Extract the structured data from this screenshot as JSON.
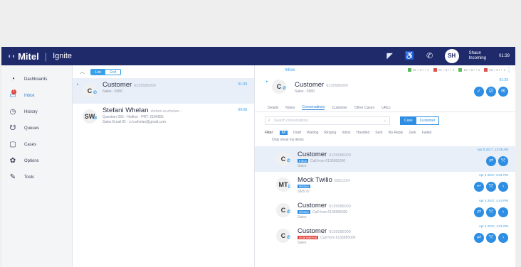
{
  "app": {
    "brand": "Mitel",
    "product": "Ignite"
  },
  "topbar": {
    "icons": [
      "megaphone-icon",
      "accessibility-icon",
      "phone-icon"
    ],
    "avatar_initials": "SH",
    "user_name": "Shaun",
    "user_status": "Incoming",
    "clock": "01:39"
  },
  "sidebar": {
    "items": [
      {
        "label": "Dashboards",
        "icon": "dashboard-icon"
      },
      {
        "label": "Inbox",
        "icon": "inbox-icon",
        "badge": "1"
      },
      {
        "label": "History",
        "icon": "history-icon"
      },
      {
        "label": "Queues",
        "icon": "queues-icon"
      },
      {
        "label": "Cases",
        "icon": "cases-icon"
      },
      {
        "label": "Options",
        "icon": "options-icon"
      },
      {
        "label": "Tools",
        "icon": "tools-icon"
      }
    ]
  },
  "list": {
    "toggle": [
      "List",
      "Grid"
    ],
    "items": [
      {
        "initials": "C",
        "name": "Customer",
        "number": "6135585000",
        "sub": "Sales - 5000",
        "time": "01:39"
      },
      {
        "initials": "SW",
        "name": "Stefani Whelan",
        "number": "stefani.w.whelan...",
        "sub": "Question 055 - Hotline - PRT: 2184855",
        "sub2": "Sales Email ID - s.h.whelan@gmail.com",
        "time": "09:08"
      }
    ]
  },
  "detail": {
    "title": "Inbox",
    "stats": [
      "26 + 0 / + 1",
      "26 + 0 / + 1",
      "10 + 0 / + 1",
      "26 + 0 / + 1"
    ],
    "card": {
      "initials": "C",
      "name": "Customer",
      "number": "6135585000",
      "sub": "Sales - 5000",
      "time": "01:39"
    },
    "tabs": [
      "Details",
      "Notes",
      "Conversations",
      "Customer",
      "Other Cases",
      "URLs"
    ],
    "search_placeholder": "Search conversations",
    "scope": [
      "Case",
      "Customer"
    ],
    "filter_label": "Filter:",
    "filters": [
      "All",
      "Draft",
      "Waiting",
      "Ringing",
      "Inbox",
      "Handled",
      "Sent",
      "No Reply",
      "Junk",
      "Failed"
    ],
    "only_mine": "Only show my items",
    "conversations": [
      {
        "initials": "C",
        "name": "Customer",
        "number": "6135585000",
        "tag": "Inbox",
        "line": "Call from 6135585000",
        "sub": "Sales",
        "time": "Apr 5 2017, 12:09 AM"
      },
      {
        "initials": "MT",
        "name": "Mock Twilio",
        "number": "5551234",
        "tag": "History",
        "line": "",
        "sub": "SMS IV",
        "time": "Apr 4 2017, 5:01 PM"
      },
      {
        "initials": "C",
        "name": "Customer",
        "number": "6135585000",
        "tag": "History",
        "line": "Call from 6135585000",
        "sub": "Sales",
        "time": "Apr 4 2017, 4:44 PM"
      },
      {
        "initials": "C",
        "name": "Customer",
        "number": "6135585000",
        "tag": "Unanswered",
        "line": "Call from 6135585000",
        "sub": "Sales",
        "time": "Apr 4 2017, 4:31 PM"
      }
    ]
  },
  "colors": {
    "topbar": "#1f2a6b",
    "accent": "#2e8ee3",
    "selected_row": "#e9eff8",
    "alert": "#e0453f"
  }
}
